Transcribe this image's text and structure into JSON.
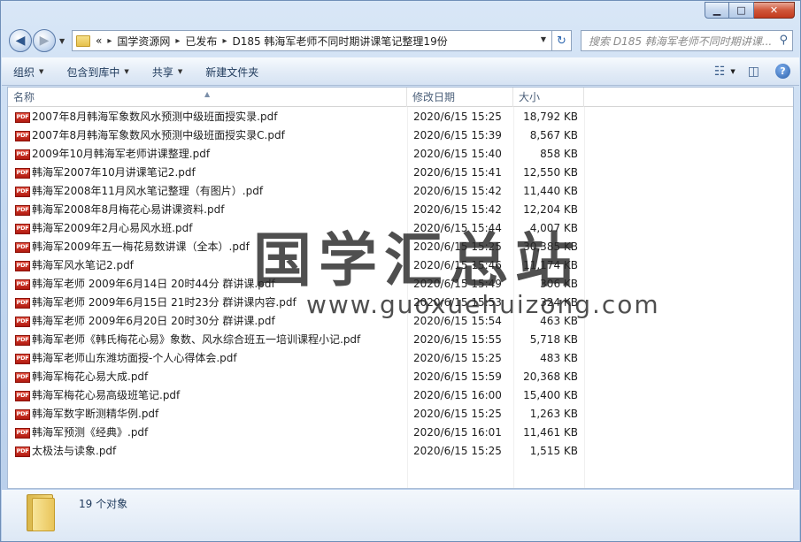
{
  "window": {
    "minimize": "▁",
    "maximize": "□",
    "close": "✕"
  },
  "nav": {
    "back": "◀",
    "forward": "▶",
    "history_drop": "▼"
  },
  "address": {
    "overflow": "«",
    "crumbs": [
      "国学资源网",
      "已发布",
      "D185 韩海军老师不同时期讲课笔记整理19份"
    ],
    "separator": "▸",
    "drop": "▼"
  },
  "refresh_glyph": "↻",
  "search": {
    "placeholder": "搜索 D185 韩海军老师不同时期讲课...",
    "icon": "⚲"
  },
  "toolbar": {
    "organize": "组织",
    "include_library": "包含到库中",
    "share": "共享",
    "new_folder": "新建文件夹",
    "view_glyph": "☷",
    "pane_glyph": "◫",
    "help_glyph": "?"
  },
  "columns": {
    "name": "名称",
    "modified": "修改日期",
    "size": "大小"
  },
  "files": [
    {
      "name": "2007年8月韩海军象数风水预测中级班面授实录.pdf",
      "date": "2020/6/15 15:25",
      "size": "18,792 KB"
    },
    {
      "name": "2007年8月韩海军象数风水预测中级班面授实录C.pdf",
      "date": "2020/6/15 15:39",
      "size": "8,567 KB"
    },
    {
      "name": "2009年10月韩海军老师讲课整理.pdf",
      "date": "2020/6/15 15:40",
      "size": "858 KB"
    },
    {
      "name": "韩海军2007年10月讲课笔记2.pdf",
      "date": "2020/6/15 15:41",
      "size": "12,550 KB"
    },
    {
      "name": "韩海军2008年11月风水笔记整理（有图片）.pdf",
      "date": "2020/6/15 15:42",
      "size": "11,440 KB"
    },
    {
      "name": "韩海军2008年8月梅花心易讲课资料.pdf",
      "date": "2020/6/15 15:42",
      "size": "12,204 KB"
    },
    {
      "name": "韩海军2009年2月心易风水班.pdf",
      "date": "2020/6/15 15:44",
      "size": "4,007 KB"
    },
    {
      "name": "韩海军2009年五一梅花易数讲课（全本）.pdf",
      "date": "2020/6/15 15:25",
      "size": "30,385 KB"
    },
    {
      "name": "韩海军风水笔记2.pdf",
      "date": "2020/6/15 15:46",
      "size": "11,174 KB"
    },
    {
      "name": "韩海军老师  2009年6月14日  20时44分  群讲课.pdf",
      "date": "2020/6/15 15:49",
      "size": "306 KB"
    },
    {
      "name": "韩海军老师  2009年6月15日  21时23分  群讲课内容.pdf",
      "date": "2020/6/15 15:53",
      "size": "324 KB"
    },
    {
      "name": "韩海军老师  2009年6月20日  20时30分  群讲课.pdf",
      "date": "2020/6/15 15:54",
      "size": "463 KB"
    },
    {
      "name": "韩海军老师《韩氏梅花心易》象数、风水综合班五一培训课程小记.pdf",
      "date": "2020/6/15 15:55",
      "size": "5,718 KB"
    },
    {
      "name": "韩海军老师山东潍坊面授-个人心得体会.pdf",
      "date": "2020/6/15 15:25",
      "size": "483 KB"
    },
    {
      "name": "韩海军梅花心易大成.pdf",
      "date": "2020/6/15 15:59",
      "size": "20,368 KB"
    },
    {
      "name": "韩海军梅花心易高级班笔记.pdf",
      "date": "2020/6/15 16:00",
      "size": "15,400 KB"
    },
    {
      "name": "韩海军数字断测精华例.pdf",
      "date": "2020/6/15 15:25",
      "size": "1,263 KB"
    },
    {
      "name": "韩海军预测《经典》.pdf",
      "date": "2020/6/15 16:01",
      "size": "11,461 KB"
    },
    {
      "name": "太极法与读象.pdf",
      "date": "2020/6/15 15:25",
      "size": "1,515 KB"
    }
  ],
  "pdf_icon_label": "PDF",
  "status": {
    "count": "19 个对象"
  },
  "watermark": {
    "cn": "国学汇总站",
    "url": "www.guoxuehuizong.com"
  }
}
